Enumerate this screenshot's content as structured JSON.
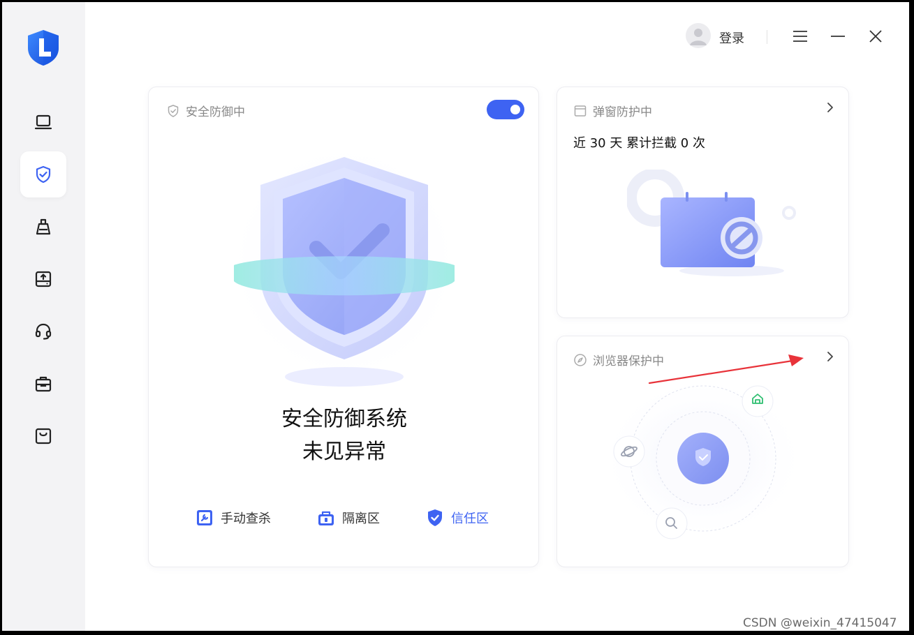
{
  "topbar": {
    "login_label": "登录"
  },
  "sidebar": {
    "items": [
      {
        "name": "computer",
        "icon": "laptop-icon"
      },
      {
        "name": "protection",
        "icon": "shield-check-icon",
        "active": true
      },
      {
        "name": "cleanup",
        "icon": "broom-icon"
      },
      {
        "name": "storage",
        "icon": "upload-drive-icon"
      },
      {
        "name": "support",
        "icon": "headset-icon"
      },
      {
        "name": "toolbox",
        "icon": "toolbox-icon"
      },
      {
        "name": "store",
        "icon": "shopping-bag-icon"
      }
    ]
  },
  "main_card": {
    "title": "安全防御中",
    "toggle_on": true,
    "status_line1": "安全防御系统",
    "status_line2": "未见异常",
    "actions": [
      {
        "label": "手动查杀",
        "icon": "manual-scan-icon"
      },
      {
        "label": "隔离区",
        "icon": "quarantine-icon"
      },
      {
        "label": "信任区",
        "icon": "trust-shield-icon",
        "active": true
      }
    ]
  },
  "popup_card": {
    "title": "弹窗防护中",
    "stat": "近 30 天 累计拦截 0 次"
  },
  "browser_card": {
    "title": "浏览器保护中"
  },
  "watermark": "CSDN @weixin_47415047",
  "colors": {
    "accent": "#3e63f2",
    "sidebar_bg": "#f3f3f5",
    "annotation_arrow": "#e8333a"
  }
}
